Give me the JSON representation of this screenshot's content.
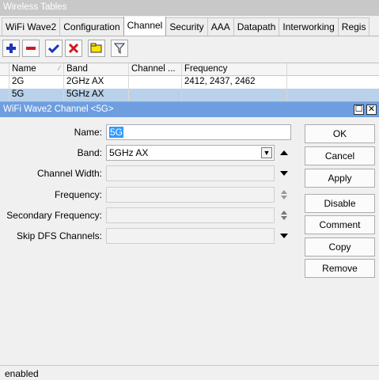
{
  "window": {
    "title": "Wireless Tables"
  },
  "tabs": [
    "WiFi Wave2",
    "Configuration",
    "Channel",
    "Security",
    "AAA",
    "Datapath",
    "Interworking",
    "Regis"
  ],
  "toolbar": {
    "buttons": [
      {
        "name": "add-button",
        "icon": "plus-icon"
      },
      {
        "name": "remove-button",
        "icon": "minus-icon"
      },
      {
        "name": "enable-button",
        "icon": "check-icon"
      },
      {
        "name": "disable-button",
        "icon": "x-icon"
      },
      {
        "name": "comment-button",
        "icon": "note-icon"
      },
      {
        "name": "filter-button",
        "icon": "filter-icon"
      }
    ]
  },
  "table": {
    "columns": [
      "Name",
      "Band",
      "Channel ...",
      "Frequency"
    ],
    "rows": [
      {
        "name": "2G",
        "band": "2GHz AX",
        "channel": "",
        "frequency": "2412, 2437, 2462"
      },
      {
        "name": "5G",
        "band": "5GHz AX",
        "channel": "",
        "frequency": ""
      }
    ]
  },
  "dialog": {
    "title": "WiFi Wave2 Channel <5G>",
    "fields": {
      "name": {
        "label": "Name:",
        "value": "5G"
      },
      "band": {
        "label": "Band:",
        "value": "5GHz AX"
      },
      "channel_width": {
        "label": "Channel Width:",
        "value": ""
      },
      "frequency": {
        "label": "Frequency:",
        "value": ""
      },
      "secondary_frequency": {
        "label": "Secondary Frequency:",
        "value": ""
      },
      "skip_dfs": {
        "label": "Skip DFS Channels:",
        "value": ""
      }
    },
    "buttons": {
      "ok": "OK",
      "cancel": "Cancel",
      "apply": "Apply",
      "disable": "Disable",
      "comment": "Comment",
      "copy": "Copy",
      "remove": "Remove"
    }
  },
  "status": {
    "text": "enabled"
  },
  "colors": {
    "titlebar": "#c8c8c8",
    "dialog_titlebar": "#6e9ee0",
    "selected_row": "#b9d1ea",
    "selection": "#3399ff"
  }
}
